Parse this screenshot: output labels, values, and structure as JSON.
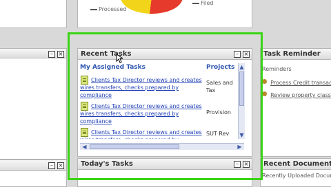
{
  "background": {
    "legend_1": "Processed",
    "legend_2": "Filed"
  },
  "recent_tasks": {
    "title": "Recent Tasks",
    "col_tasks": "My Assigned Tasks",
    "col_projects": "Projects",
    "rows": [
      {
        "task": "Clients Tax Director reviews and creates wires transfers, checks prepared by compliance",
        "project": "Sales and Tax"
      },
      {
        "task": "Clients Tax Director reviews and creates wires transfers, checks prepared by compliance",
        "project": "Provision"
      },
      {
        "task": "Clients Tax Director reviews and creates wires transfers, checks prepared by compliance",
        "project": "SUT Rev"
      }
    ],
    "minimize": "–",
    "close": "×"
  },
  "todays_tasks": {
    "title": "Today's Tasks",
    "minimize": "–",
    "close": "×"
  },
  "task_reminder": {
    "title": "Task Reminder",
    "subtitle": "Reminders",
    "items": [
      "Process Credit transactions",
      "Review property classes"
    ]
  },
  "recent_documents": {
    "title": "Recent Documents",
    "subtitle": "Recently Uploaded Documents"
  },
  "colors": {
    "highlight": "#39d414",
    "link": "#1f3fb5",
    "heading": "#2e56b0"
  }
}
